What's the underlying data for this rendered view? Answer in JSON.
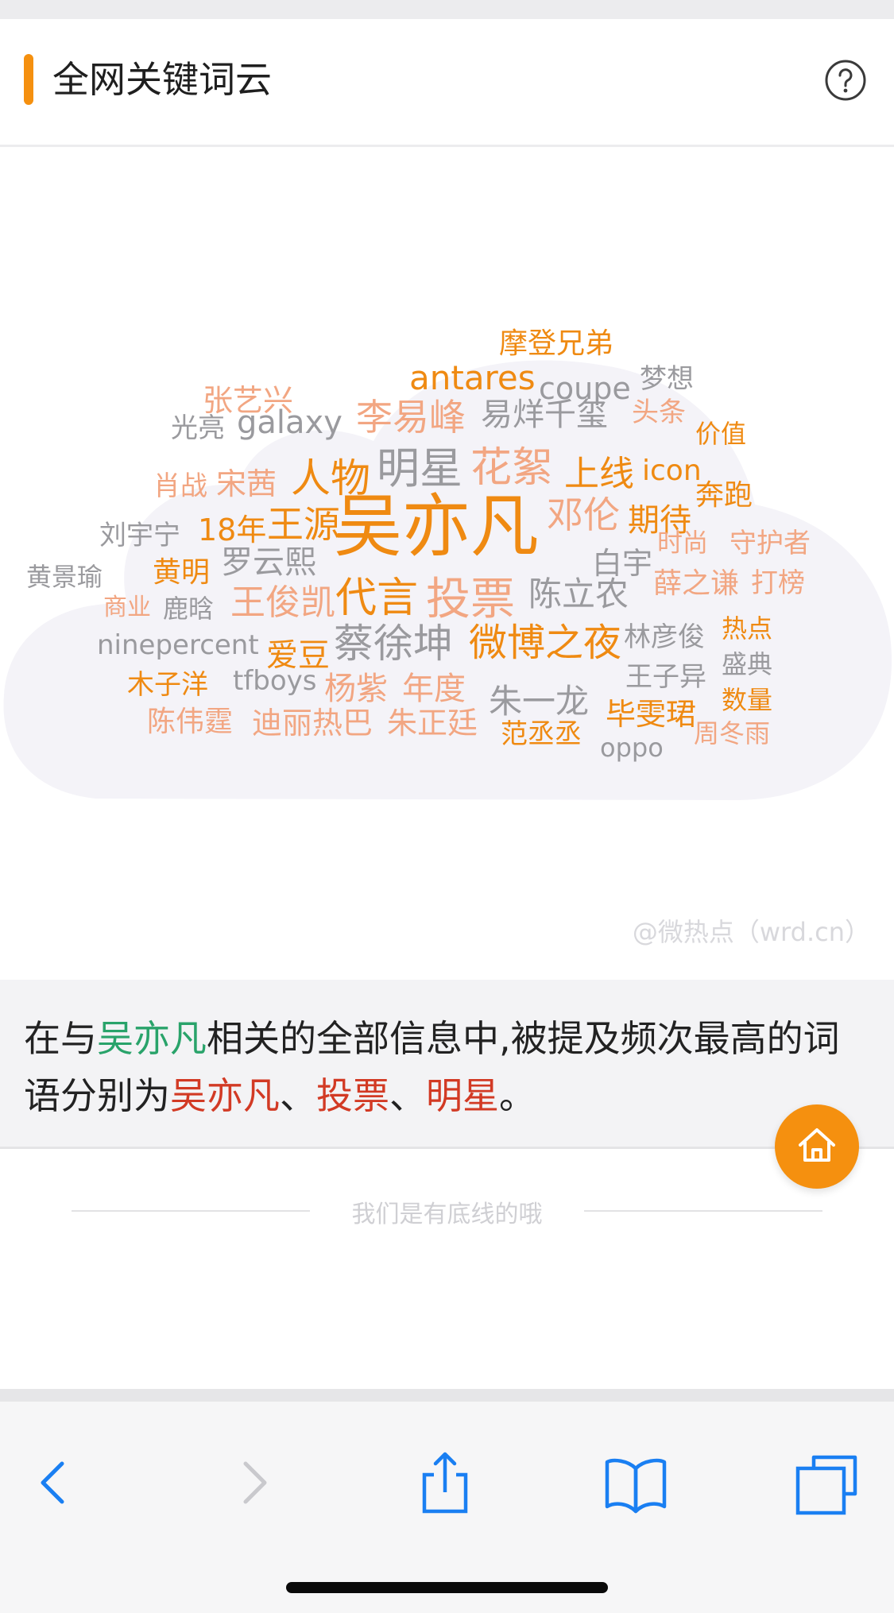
{
  "colors": {
    "accent": "#f5900f",
    "word_orange": "#ef8a12",
    "word_peach": "#f2a682",
    "word_gray": "#9a9a9e",
    "highlight_green": "#29a36a",
    "highlight_red": "#d23a24",
    "toolbar_blue": "#1a7ff2"
  },
  "header": {
    "title": "全网关键词云",
    "help_icon": "question-circle-icon"
  },
  "word_cloud": {
    "words": [
      {
        "text": "摩登兄弟",
        "color": "orange"
      },
      {
        "text": "antares",
        "color": "orange"
      },
      {
        "text": "coupe",
        "color": "gray"
      },
      {
        "text": "梦想",
        "color": "gray"
      },
      {
        "text": "张艺兴",
        "color": "peach"
      },
      {
        "text": "光亮",
        "color": "gray"
      },
      {
        "text": "galaxy",
        "color": "gray"
      },
      {
        "text": "李易峰",
        "color": "peach"
      },
      {
        "text": "易烊千玺",
        "color": "gray"
      },
      {
        "text": "头条",
        "color": "peach"
      },
      {
        "text": "价值",
        "color": "orange"
      },
      {
        "text": "肖战",
        "color": "peach"
      },
      {
        "text": "宋茜",
        "color": "peach"
      },
      {
        "text": "人物",
        "color": "orange"
      },
      {
        "text": "明星",
        "color": "gray"
      },
      {
        "text": "花絮",
        "color": "peach"
      },
      {
        "text": "上线",
        "color": "orange"
      },
      {
        "text": "icon",
        "color": "orange"
      },
      {
        "text": "奔跑",
        "color": "orange"
      },
      {
        "text": "刘宇宁",
        "color": "gray"
      },
      {
        "text": "18年",
        "color": "orange"
      },
      {
        "text": "王源",
        "color": "orange"
      },
      {
        "text": "吴亦凡",
        "color": "orange"
      },
      {
        "text": "邓伦",
        "color": "peach"
      },
      {
        "text": "期待",
        "color": "orange"
      },
      {
        "text": "时尚",
        "color": "peach"
      },
      {
        "text": "守护者",
        "color": "peach"
      },
      {
        "text": "黄景瑜",
        "color": "gray"
      },
      {
        "text": "黄明",
        "color": "orange"
      },
      {
        "text": "罗云熙",
        "color": "gray"
      },
      {
        "text": "白宇",
        "color": "gray"
      },
      {
        "text": "商业",
        "color": "peach"
      },
      {
        "text": "鹿晗",
        "color": "gray"
      },
      {
        "text": "王俊凯",
        "color": "peach"
      },
      {
        "text": "代言",
        "color": "orange"
      },
      {
        "text": "投票",
        "color": "peach"
      },
      {
        "text": "陈立农",
        "color": "gray"
      },
      {
        "text": "薛之谦",
        "color": "peach"
      },
      {
        "text": "打榜",
        "color": "peach"
      },
      {
        "text": "ninepercent",
        "color": "gray"
      },
      {
        "text": "蔡徐坤",
        "color": "gray"
      },
      {
        "text": "林彦俊",
        "color": "gray"
      },
      {
        "text": "热点",
        "color": "orange"
      },
      {
        "text": "爱豆",
        "color": "orange"
      },
      {
        "text": "微博之夜",
        "color": "orange"
      },
      {
        "text": "盛典",
        "color": "gray"
      },
      {
        "text": "木子洋",
        "color": "orange"
      },
      {
        "text": "tfboys",
        "color": "gray"
      },
      {
        "text": "杨紫",
        "color": "peach"
      },
      {
        "text": "年度",
        "color": "peach"
      },
      {
        "text": "王子异",
        "color": "gray"
      },
      {
        "text": "朱一龙",
        "color": "gray"
      },
      {
        "text": "数量",
        "color": "orange"
      },
      {
        "text": "陈伟霆",
        "color": "peach"
      },
      {
        "text": "迪丽热巴",
        "color": "peach"
      },
      {
        "text": "朱正廷",
        "color": "peach"
      },
      {
        "text": "毕雯珺",
        "color": "orange"
      },
      {
        "text": "范丞丞",
        "color": "orange"
      },
      {
        "text": "周冬雨",
        "color": "peach"
      },
      {
        "text": "oppo",
        "color": "gray"
      }
    ]
  },
  "watermark": "@微热点（wrd.cn）",
  "summary": {
    "prefix": "在与",
    "subject": "吴亦凡",
    "middle": "相关的全部信息中,被提及频次最高的词语分别为",
    "top1": "吴亦凡",
    "sep1": "、",
    "top2": "投票",
    "sep2": "、",
    "top3": "明星",
    "suffix": "。"
  },
  "home_button_icon": "home-icon",
  "footer_note": "我们是有底线的哦",
  "toolbar": {
    "back_icon": "back-chevron-icon",
    "forward_icon": "forward-chevron-icon",
    "share_icon": "share-icon",
    "bookmarks_icon": "bookmarks-icon",
    "tabs_icon": "tabs-icon"
  }
}
